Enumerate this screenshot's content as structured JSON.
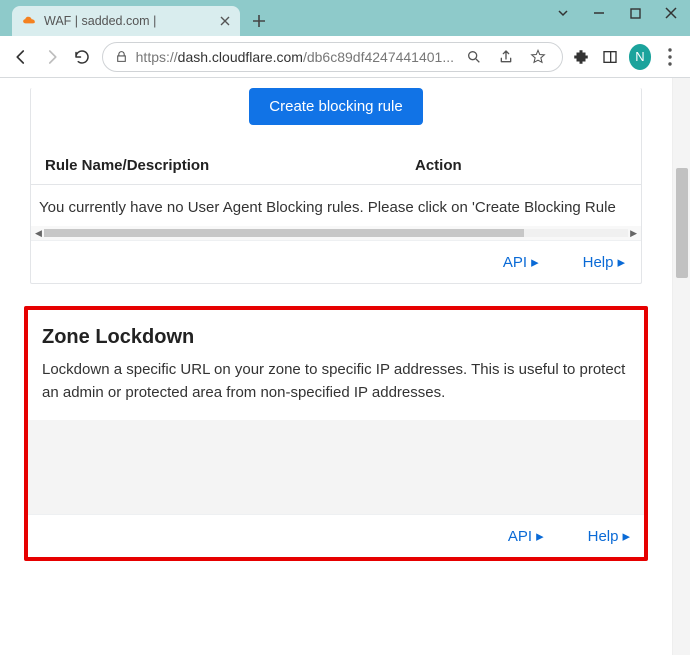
{
  "chrome": {
    "tab_title": "WAF | sadded.com |",
    "url_protocol": "https://",
    "url_host": "dash.cloudflare.com",
    "url_path": "/db6c89df4247441401...",
    "avatar_letter": "N"
  },
  "blocking": {
    "create_button": "Create blocking rule",
    "col_name": "Rule Name/Description",
    "col_action": "Action",
    "empty_msg": "You currently have no User Agent Blocking rules. Please click on 'Create Blocking Rule",
    "api_link": "API",
    "help_link": "Help"
  },
  "lockdown": {
    "title": "Zone Lockdown",
    "description": "Lockdown a specific URL on your zone to specific IP addresses. This is useful to protect an admin or protected area from non-specified IP addresses.",
    "api_link": "API",
    "help_link": "Help"
  }
}
